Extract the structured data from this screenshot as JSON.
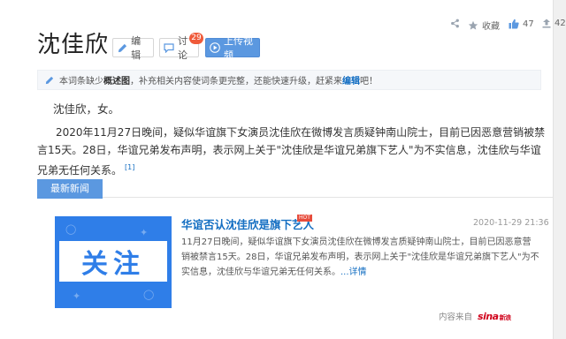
{
  "header": {
    "title": "沈佳欣",
    "edit_label": "编辑",
    "discuss_label": "讨论",
    "discuss_count": "29",
    "upload_label": "上传视频"
  },
  "actions": {
    "fav_label": "收藏",
    "like_count": "47",
    "more_count": "42"
  },
  "notice": {
    "prefix": "本词条缺少",
    "missing": "概述图",
    "middle": "，补充相关内容使词条更完整，还能快速升级，赶紧来",
    "link": "编辑",
    "suffix": "吧！"
  },
  "content": {
    "summary": "沈佳欣，女。",
    "paragraph": "2020年11月27日晚间，疑似华谊旗下女演员沈佳欣在微博发言质疑钟南山院士，目前已因恶意营销被禁言15天。28日，华谊兄弟发布声明，表示网上关于\"沈佳欣是华谊兄弟旗下艺人\"为不实信息，沈佳欣与华谊兄弟无任何关系。",
    "ref": "[1]"
  },
  "news": {
    "tab_label": "最新新闻",
    "thumb_text": "关注",
    "title": "华谊否认沈佳欣是旗下艺人",
    "hot_badge": "HOT",
    "date": "2020-11-29 21:36",
    "body": "11月27日晚间，疑似华谊旗下女演员沈佳欣在微博发言质疑钟南山院士，目前已因恶意营销被禁言15天。28日，华谊兄弟发布声明，表示网上关于\"沈佳欣是华谊兄弟旗下艺人\"为不实信息，沈佳欣与华谊兄弟无任何关系。",
    "more_label": "...详情",
    "source_label": "内容来自",
    "source_logo": "sina",
    "source_logo_sub": "新浪"
  },
  "colors": {
    "accent": "#5b98e0",
    "link": "#136ec2",
    "badge": "#ef5a3a",
    "thumb_bg": "#2f7ee8"
  },
  "icons": [
    "share-icon",
    "star-icon",
    "thumb-up-icon",
    "share-count-icon",
    "pencil-icon",
    "chat-icon",
    "upload-icon",
    "info-pencil-icon"
  ]
}
